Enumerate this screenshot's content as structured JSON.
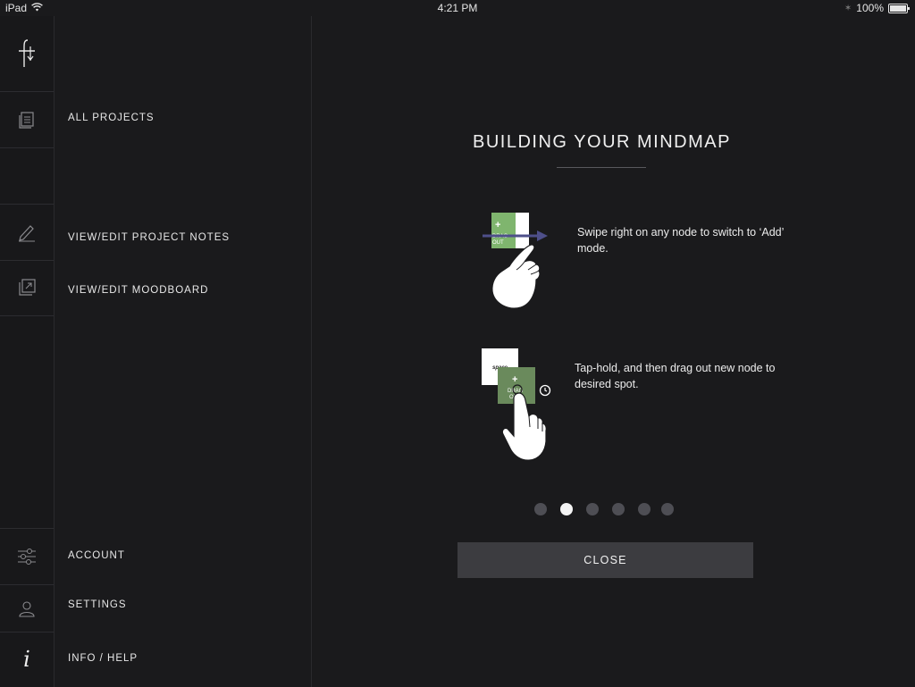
{
  "status_bar": {
    "device": "iPad",
    "time": "4:21 PM",
    "battery": "100%"
  },
  "rail": {
    "icons": [
      "logo-icon",
      "projects-icon",
      "notes-pen-icon",
      "moodboard-icon",
      "sliders-icon",
      "user-icon",
      "info-icon"
    ]
  },
  "menu": {
    "all_projects": "ALL PROJECTS",
    "project_notes": "VIEW/EDIT PROJECT NOTES",
    "moodboard": "VIEW/EDIT MOODBOARD",
    "account": "ACCOUNT",
    "settings": "SETTINGS",
    "info_help": "INFO / HELP"
  },
  "tutorial": {
    "title": "BUILDING YOUR MINDMAP",
    "steps": [
      {
        "text": "Swipe right on any node to switch to ‘Add’ mode.",
        "icon": "swipe-hand-icon",
        "illustration_labels": [
          "+",
          "DRAG",
          "OUT"
        ]
      },
      {
        "text": "Tap-hold, and then drag out new node to desired spot.",
        "icon": "tap-hold-hand-icon",
        "illustration_labels": [
          "space",
          "+",
          "DRAG",
          "OUT"
        ]
      }
    ],
    "page_indicator": {
      "total": 6,
      "current": 2
    },
    "close_label": "CLOSE"
  },
  "colors": {
    "background": "#1a1a1c",
    "node_green": "#7fb56e",
    "node_dark_green": "#6a8a5c",
    "swipe_arrow": "#4e4f8a",
    "button": "#3c3c40"
  }
}
